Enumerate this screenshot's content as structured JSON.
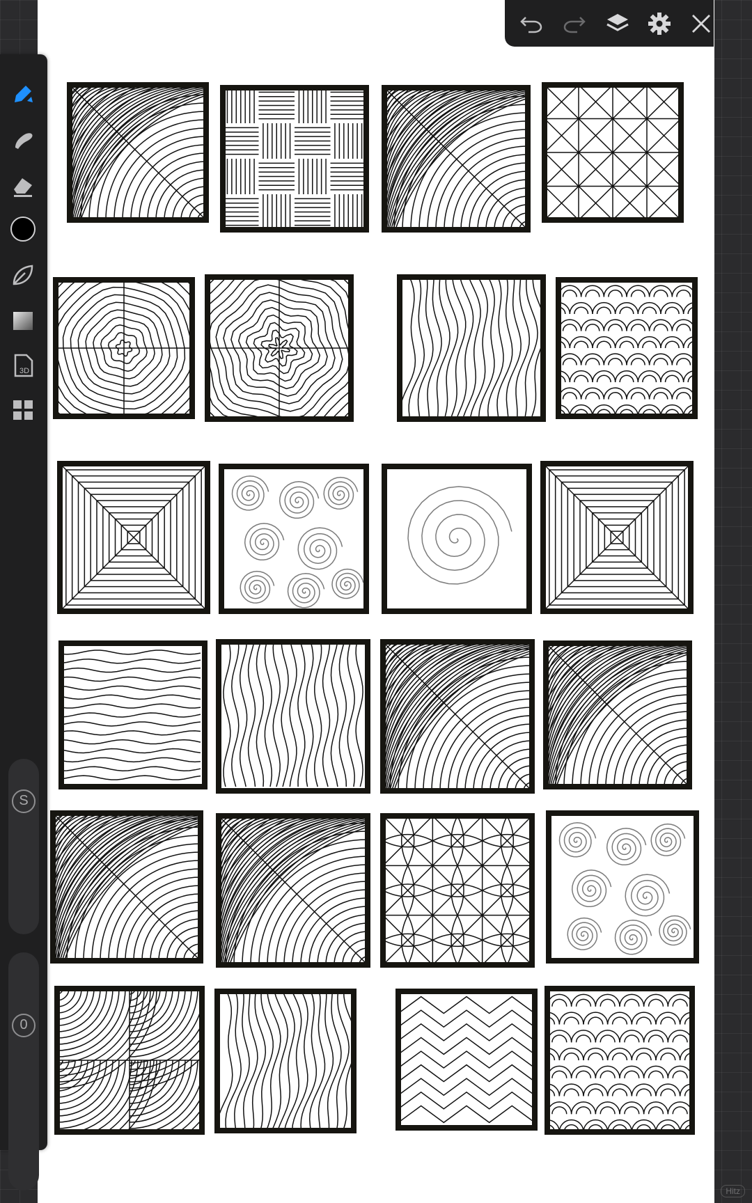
{
  "app": {
    "accent": "#1e90ff",
    "canvas_bg": "#ffffff",
    "rail_bg": "#1f1f20"
  },
  "toolbar_left": {
    "tools": [
      {
        "name": "brush-tool",
        "active": true
      },
      {
        "name": "smudge-tool",
        "active": false
      },
      {
        "name": "eraser-tool",
        "active": false
      },
      {
        "name": "color-swatch",
        "color": "#000000"
      },
      {
        "name": "selection-tool",
        "active": false
      },
      {
        "name": "gradient-tool",
        "active": false
      },
      {
        "name": "3d-file-tool",
        "label": "3D"
      },
      {
        "name": "gallery-tool",
        "active": false
      }
    ],
    "size_label": "S",
    "opacity_label": "0"
  },
  "toolbar_top": {
    "buttons": [
      "undo-icon",
      "redo-icon",
      "layers-icon",
      "settings-icon",
      "close-icon"
    ]
  },
  "canvas": {
    "tile_patterns": [
      [
        "diag-boxes",
        "weave",
        "spiral-blocks",
        "diamond-grid"
      ],
      [
        "concentric",
        "flower-concentric",
        "organic-waves",
        "scales"
      ],
      [
        "pyramid-x",
        "swirls",
        "big-spiral",
        "nested-squares"
      ],
      [
        "horizontal-waves",
        "vertical-waves",
        "arcs-diagonal",
        "arcs-diagonal-2"
      ],
      [
        "arcs-diagonal-3",
        "arcs-diagonal-4",
        "star-flowers",
        "stacked-circles"
      ],
      [
        "quadrant-arcs",
        "flowing-lines",
        "zigzag",
        "fish-scales"
      ]
    ]
  },
  "watermark": "Hitz"
}
